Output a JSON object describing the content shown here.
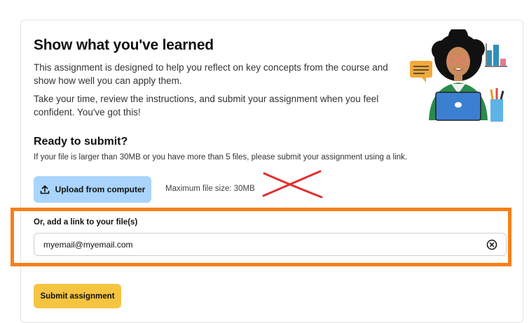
{
  "header": {
    "title": "Show what you've learned",
    "description1": "This assignment is designed to help you reflect on key concepts from the course and show how well you can apply them.",
    "description2": "Take your time, review the instructions, and submit your assignment when you feel confident. You've got this!"
  },
  "submit_section": {
    "title": "Ready to submit?",
    "help_text": "If your file is larger than 30MB or you have more than 5 files, please submit your assignment using a link.",
    "upload_label": "Upload from computer",
    "max_file_size": "Maximum file size: 30MB",
    "link_label": "Or, add a link to your file(s)",
    "link_value": "myemail@myemail.com",
    "submit_label": "Submit assignment"
  },
  "icons": {
    "upload": "upload-icon",
    "clear": "clear-circle-x-icon",
    "illustration": "student-with-laptop-illustration"
  },
  "colors": {
    "upload_button": "#a9d4fb",
    "submit_button": "#f5c440",
    "highlight_box": "#f77f1a",
    "annotation_x": "#e03030"
  }
}
